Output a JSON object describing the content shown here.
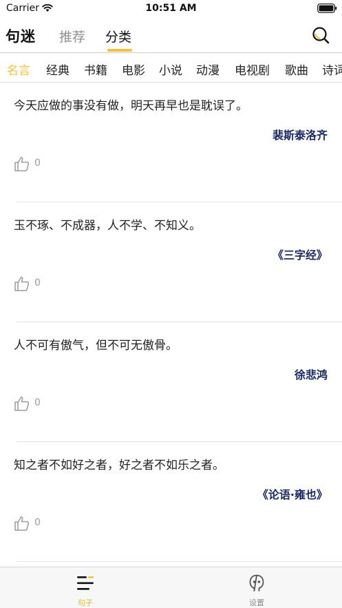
{
  "status_bar": {
    "carrier": "Carrier",
    "time": "10:51 AM"
  },
  "nav": {
    "logo": "句迷",
    "tabs": [
      {
        "label": "推荐",
        "active": false
      },
      {
        "label": "分类",
        "active": true
      }
    ],
    "accent_color": "#f2c23c"
  },
  "categories": [
    {
      "label": "名言",
      "active": true
    },
    {
      "label": "经典",
      "active": false
    },
    {
      "label": "书籍",
      "active": false
    },
    {
      "label": "电影",
      "active": false
    },
    {
      "label": "小说",
      "active": false
    },
    {
      "label": "动漫",
      "active": false
    },
    {
      "label": "电视剧",
      "active": false
    },
    {
      "label": "歌曲",
      "active": false
    },
    {
      "label": "诗词",
      "active": false
    }
  ],
  "quotes": [
    {
      "text": "今天应做的事没有做，明天再早也是耽误了。",
      "author": "裴斯泰洛齐",
      "likes": "0"
    },
    {
      "text": "玉不琢、不成器，人不学、不知义。",
      "author": "《三字经》",
      "likes": "0"
    },
    {
      "text": "人不可有傲气，但不可无傲骨。",
      "author": "徐悲鸿",
      "likes": "0"
    },
    {
      "text": "知之者不如好之者，好之者不如乐之者。",
      "author": "《论语·雍也》",
      "likes": "0"
    }
  ],
  "tab_bar": {
    "items": [
      {
        "label": "句子",
        "icon": "sentence-list-icon",
        "active": true
      },
      {
        "label": "设置",
        "icon": "robot-face-icon",
        "active": false
      }
    ]
  }
}
